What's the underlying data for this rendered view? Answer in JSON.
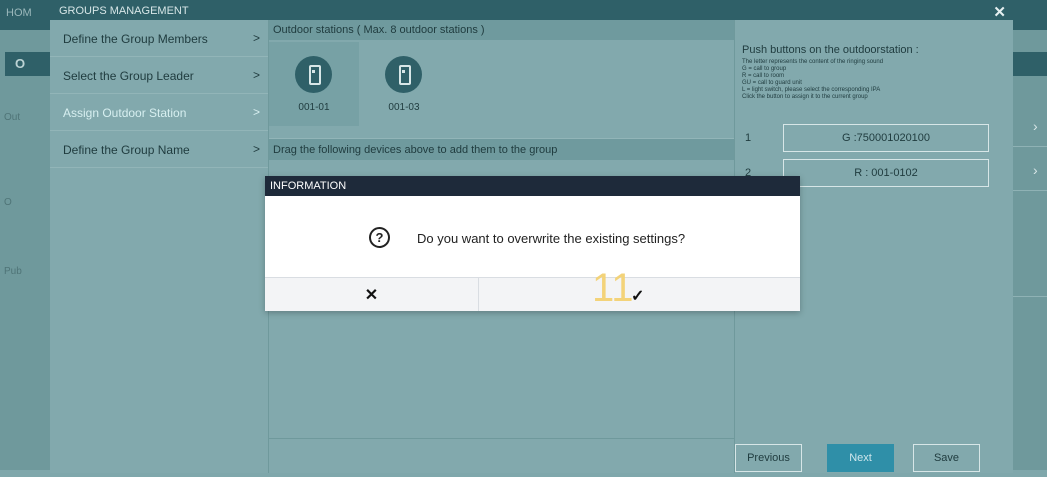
{
  "background": {
    "home_label": "HOM",
    "left_tab": "O",
    "left_labels": [
      "Out",
      "O",
      "Pub"
    ]
  },
  "window": {
    "title": "GROUPS MANAGEMENT",
    "close_icon": "close-icon"
  },
  "menu": {
    "items": [
      {
        "label": "Define the Group Members"
      },
      {
        "label": "Select the Group Leader"
      },
      {
        "label": "Assign Outdoor Station",
        "active": true
      },
      {
        "label": "Define the Group Name"
      }
    ],
    "chevron": ">"
  },
  "center": {
    "header": "Outdoor stations ( Max. 8 outdoor stations )",
    "stations": [
      {
        "label": "001-01",
        "icon": "outdoor-station-icon"
      },
      {
        "label": "001-03",
        "icon": "outdoor-station-icon"
      }
    ],
    "drag_header": "Drag the following devices above to add them to the group"
  },
  "right": {
    "title": "Push buttons on the outdoorstation :",
    "notes": [
      "The letter represents the content of the ringing sound",
      "G = call to group",
      "R = call to room",
      "GU = call to guard unit",
      "L = light switch, please select the corresponding IPA",
      "Click the button to assign it to the current group"
    ],
    "buttons": [
      {
        "num": "1",
        "value": "G :750001020100"
      },
      {
        "num": "2",
        "value": "R : 001-0102"
      }
    ]
  },
  "footer": {
    "previous": "Previous",
    "next": "Next",
    "save": "Save"
  },
  "modal": {
    "title": "INFORMATION",
    "question_icon": "question-icon",
    "message": "Do you want to overwrite the existing settings?",
    "cancel": "✕",
    "confirm": "✓",
    "badge": "11"
  },
  "colors": {
    "title_bar": "#2f6068",
    "modal_header": "#1e2a3a",
    "primary_button": "#2f8fa8",
    "badge": "#f3d37a"
  }
}
